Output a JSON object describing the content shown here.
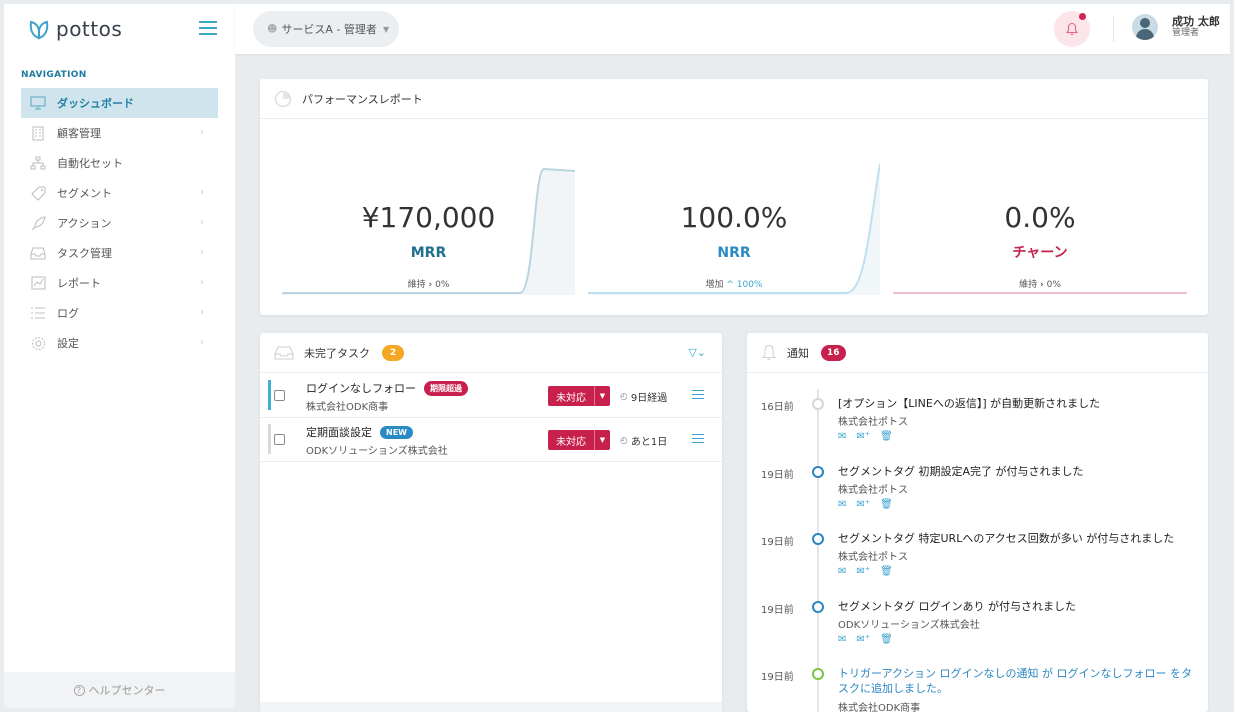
{
  "brand": {
    "name": "pottos"
  },
  "sidebar": {
    "heading": "NAVIGATION",
    "items": [
      {
        "label": "ダッシュボード",
        "icon": "monitor-icon",
        "active": true,
        "chevron": false
      },
      {
        "label": "顧客管理",
        "icon": "building-icon",
        "active": false,
        "chevron": true
      },
      {
        "label": "自動化セット",
        "icon": "sitemap-icon",
        "active": false,
        "chevron": false
      },
      {
        "label": "セグメント",
        "icon": "tag-icon",
        "active": false,
        "chevron": true
      },
      {
        "label": "アクション",
        "icon": "rocket-icon",
        "active": false,
        "chevron": true
      },
      {
        "label": "タスク管理",
        "icon": "inbox-icon",
        "active": false,
        "chevron": true
      },
      {
        "label": "レポート",
        "icon": "chart-icon",
        "active": false,
        "chevron": true
      },
      {
        "label": "ログ",
        "icon": "list-icon",
        "active": false,
        "chevron": true
      },
      {
        "label": "設定",
        "icon": "gear-icon",
        "active": false,
        "chevron": true
      }
    ],
    "help": "ヘルプセンター"
  },
  "topbar": {
    "service": "サービスA - 管理者",
    "user": {
      "name": "成功 太郎",
      "role": "管理者"
    }
  },
  "performance": {
    "title": "パフォーマンスレポート",
    "metrics": [
      {
        "value": "¥170,000",
        "label": "MRR",
        "sub_text": "維持",
        "sub_arrow": "›",
        "sub_value": "0%",
        "label_color": "#1f6f8f"
      },
      {
        "value": "100.0%",
        "label": "NRR",
        "sub_text": "増加",
        "sub_arrow": "^",
        "sub_value": "100%",
        "label_color": "#2a8bc4"
      },
      {
        "value": "0.0%",
        "label": "チャーン",
        "sub_text": "維持",
        "sub_arrow": "›",
        "sub_value": "0%",
        "label_color": "#c8204d"
      }
    ]
  },
  "tasks": {
    "title": "未完了タスク",
    "count": "2",
    "rows": [
      {
        "title": "ログインなしフォロー",
        "tag": "期限超過",
        "company": "株式会社ODK商事",
        "status": "未対応",
        "time": "9日経過"
      },
      {
        "title": "定期面談設定",
        "tag": "NEW",
        "company": "ODKソリューションズ株式会社",
        "status": "未対応",
        "time": "あと1日"
      }
    ]
  },
  "notifications": {
    "title": "通知",
    "count": "16",
    "items": [
      {
        "when": "16日前",
        "msg": "[オプション【LINEへの返信】] が自動更新されました",
        "company": "株式会社ポトス"
      },
      {
        "when": "19日前",
        "msg": "セグメントタグ 初期設定A完了 が付与されました",
        "company": "株式会社ポトス"
      },
      {
        "when": "19日前",
        "msg": "セグメントタグ 特定URLへのアクセス回数が多い が付与されました",
        "company": "株式会社ポトス"
      },
      {
        "when": "19日前",
        "msg": "セグメントタグ ログインあり が付与されました",
        "company": "ODKソリューションズ株式会社"
      },
      {
        "when": "19日前",
        "msg": "トリガーアクション ログインなしの通知 が ログインなしフォロー をタスクに追加しました。",
        "company": "株式会社ODK商事"
      }
    ]
  }
}
